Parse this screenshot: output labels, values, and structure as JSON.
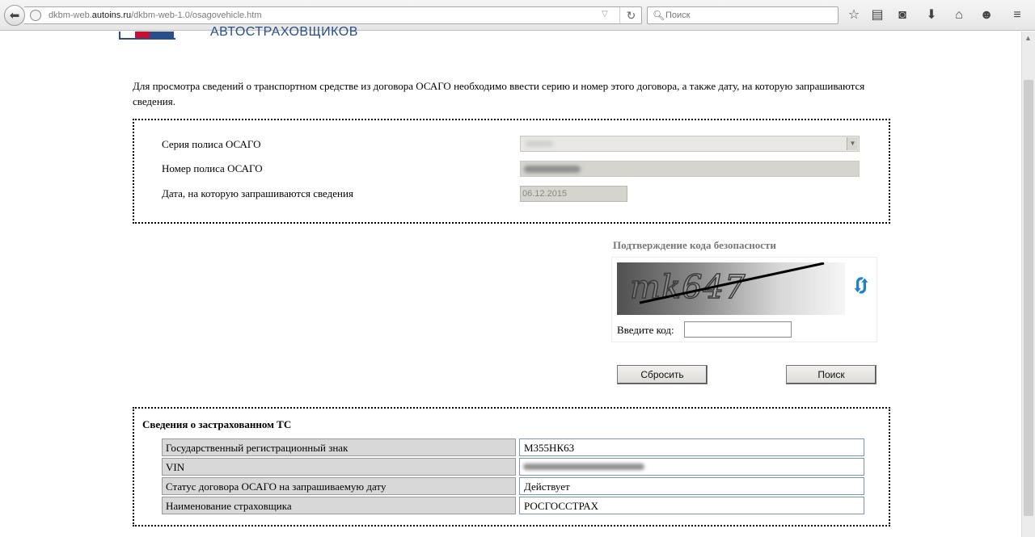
{
  "browser": {
    "url_prefix": "dkbm-web.",
    "url_domain": "autoins.ru",
    "url_path": "/dkbm-web-1.0/osagovehicle.htm",
    "search_placeholder": "Поиск",
    "icons": [
      "back-icon",
      "globe-icon",
      "dropdown-icon",
      "reload-icon",
      "search-icon",
      "star-icon",
      "reading-list-icon",
      "pocket-icon",
      "download-icon",
      "home-icon",
      "chat-icon",
      "menu-icon"
    ]
  },
  "header": {
    "org_name": "АВТОСТРАХОВЩИКОВ"
  },
  "intro_text": "Для просмотра сведений о транспортном средстве из договора ОСАГО необходимо ввести серию и номер этого договора, а также дату, на которую запрашиваются сведения.",
  "form": {
    "series_label": "Серия полиса ОСАГО",
    "number_label": "Номер полиса ОСАГО",
    "date_label": "Дата, на которую запрашиваются сведения",
    "date_value": "06.12.2015"
  },
  "captcha": {
    "title": "Подтверждение кода безопасности",
    "image_text": "mk647",
    "code_label": "Введите код:",
    "code_value": ""
  },
  "buttons": {
    "reset": "Сбросить",
    "search": "Поиск"
  },
  "result": {
    "title": "Сведения о застрахованном ТС",
    "rows": [
      {
        "label": "Государственный регистрационный знак",
        "value": "М355НК63"
      },
      {
        "label": "VIN",
        "value": ""
      },
      {
        "label": "Статус договора ОСАГО на запрашиваемую дату",
        "value": "Действует"
      },
      {
        "label": "Наименование страховщика",
        "value": "РОСГОССТРАХ"
      }
    ]
  }
}
